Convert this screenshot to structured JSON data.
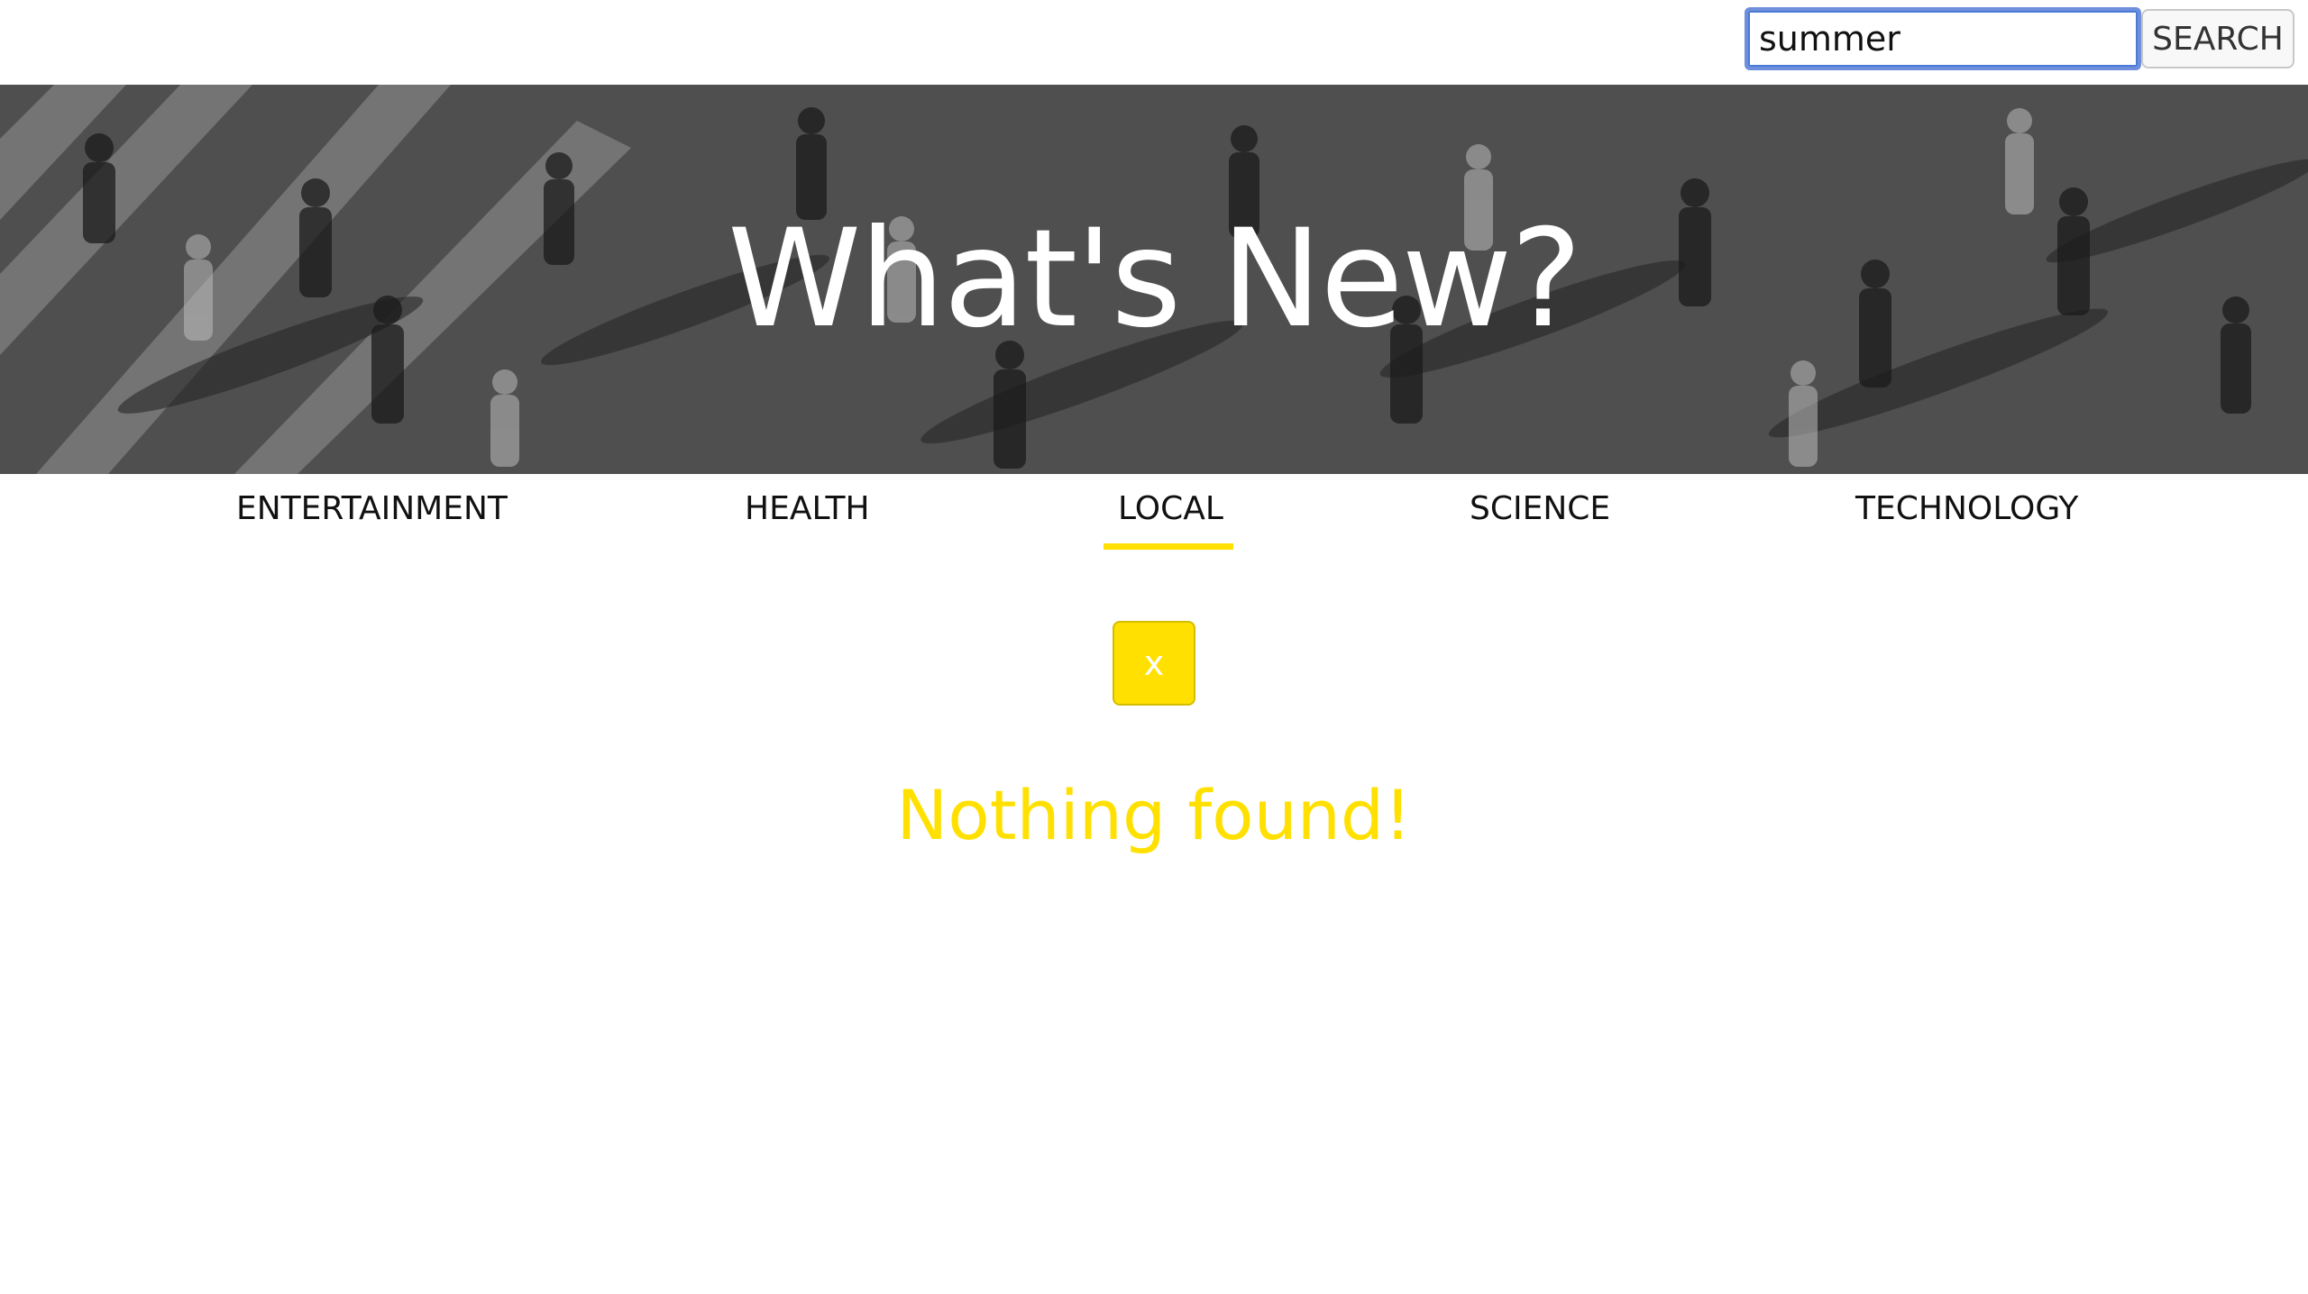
{
  "search": {
    "value": "summer",
    "button_label": "SEARCH"
  },
  "hero": {
    "title": "What's New?",
    "image": "black-and-white-crowd-crosswalk-photo"
  },
  "nav": {
    "tabs": [
      {
        "label": "ENTERTAINMENT",
        "active": false
      },
      {
        "label": "HEALTH",
        "active": false
      },
      {
        "label": "LOCAL",
        "active": true
      },
      {
        "label": "SCIENCE",
        "active": false
      },
      {
        "label": "TECHNOLOGY",
        "active": false
      }
    ]
  },
  "results": {
    "close_label": "x",
    "message": "Nothing found!"
  },
  "colors": {
    "accent": "#ffe000",
    "hero_overlay": "#4e4e4e",
    "focus_ring": "#6f8fdc"
  }
}
